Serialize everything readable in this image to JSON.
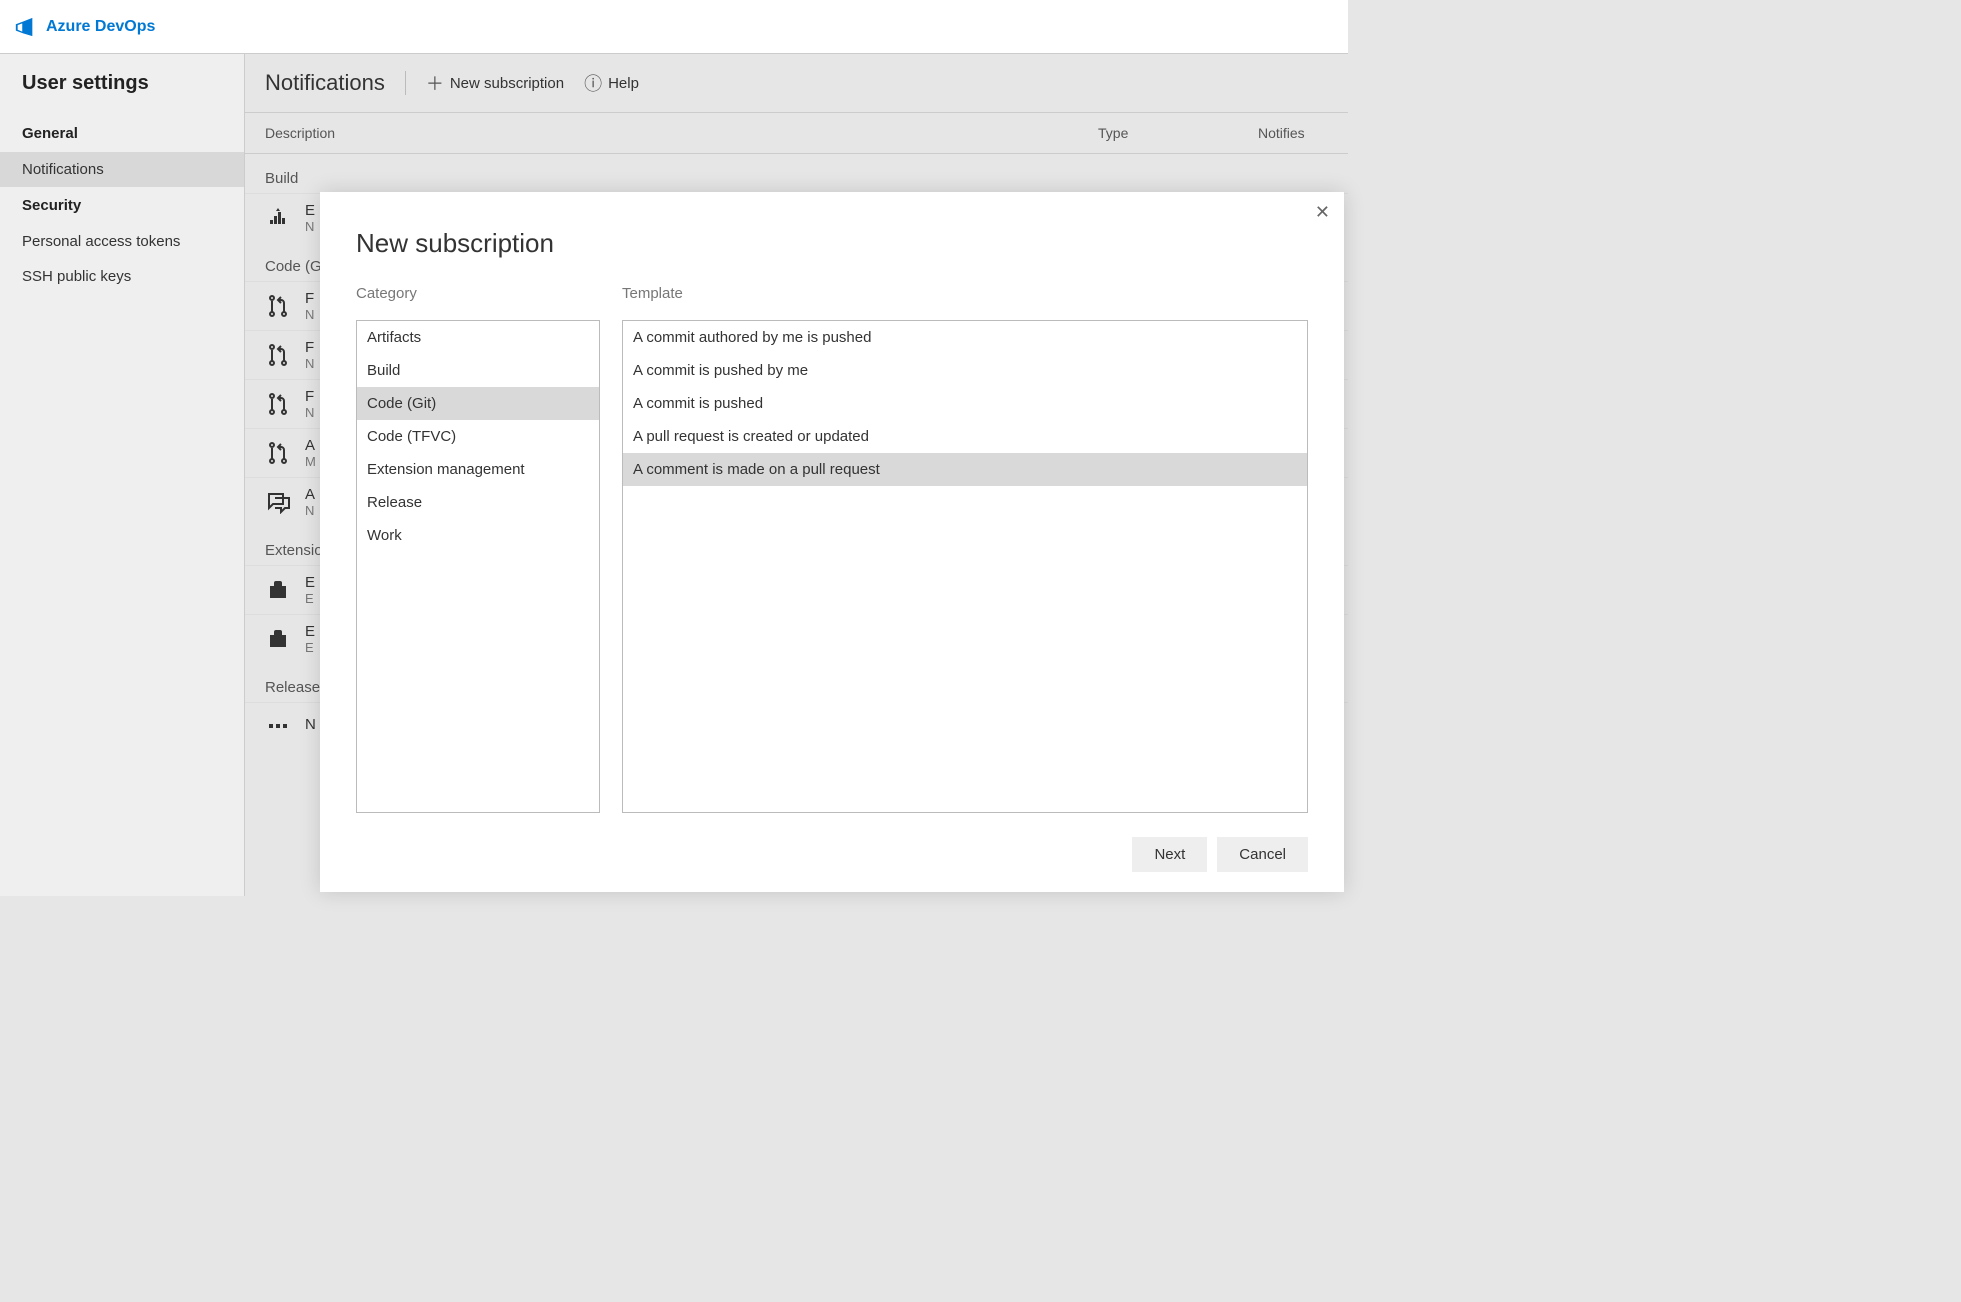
{
  "brand": "Azure DevOps",
  "sidebar": {
    "title": "User settings",
    "sections": [
      {
        "label": "General",
        "items": [
          {
            "label": "Notifications",
            "active": true
          }
        ]
      },
      {
        "label": "Security",
        "items": [
          {
            "label": "Personal access tokens"
          },
          {
            "label": "SSH public keys"
          }
        ]
      }
    ]
  },
  "page": {
    "title": "Notifications",
    "new_sub": "New subscription",
    "help": "Help"
  },
  "columns": {
    "desc": "Description",
    "type": "Type",
    "notifies": "Notifies"
  },
  "groups": [
    {
      "label": "Build",
      "icon": "build",
      "rows": [
        {
          "title": "E",
          "sub": "N"
        }
      ]
    },
    {
      "label": "Code (G",
      "icon": "pr",
      "rows": [
        {
          "title": "F",
          "sub": "N"
        },
        {
          "title": "F",
          "sub": "N"
        },
        {
          "title": "F",
          "sub": "N"
        },
        {
          "title": "A",
          "sub": "M"
        },
        {
          "title": "A",
          "sub": "N",
          "icon": "comment"
        }
      ]
    },
    {
      "label": "Extensio",
      "icon": "ext",
      "rows": [
        {
          "title": "E",
          "sub": "E"
        },
        {
          "title": "E",
          "sub": "E"
        }
      ]
    },
    {
      "label": "Release",
      "icon": "release",
      "rows": [
        {
          "title": "N",
          "sub": ""
        }
      ]
    }
  ],
  "modal": {
    "title": "New subscription",
    "category_label": "Category",
    "template_label": "Template",
    "categories": [
      {
        "label": "Artifacts"
      },
      {
        "label": "Build"
      },
      {
        "label": "Code (Git)",
        "selected": true
      },
      {
        "label": "Code (TFVC)"
      },
      {
        "label": "Extension management"
      },
      {
        "label": "Release"
      },
      {
        "label": "Work"
      }
    ],
    "templates": [
      {
        "label": "A commit authored by me is pushed"
      },
      {
        "label": "A commit is pushed by me"
      },
      {
        "label": "A commit is pushed"
      },
      {
        "label": "A pull request is created or updated"
      },
      {
        "label": "A comment is made on a pull request",
        "selected": true
      }
    ],
    "next": "Next",
    "cancel": "Cancel"
  }
}
